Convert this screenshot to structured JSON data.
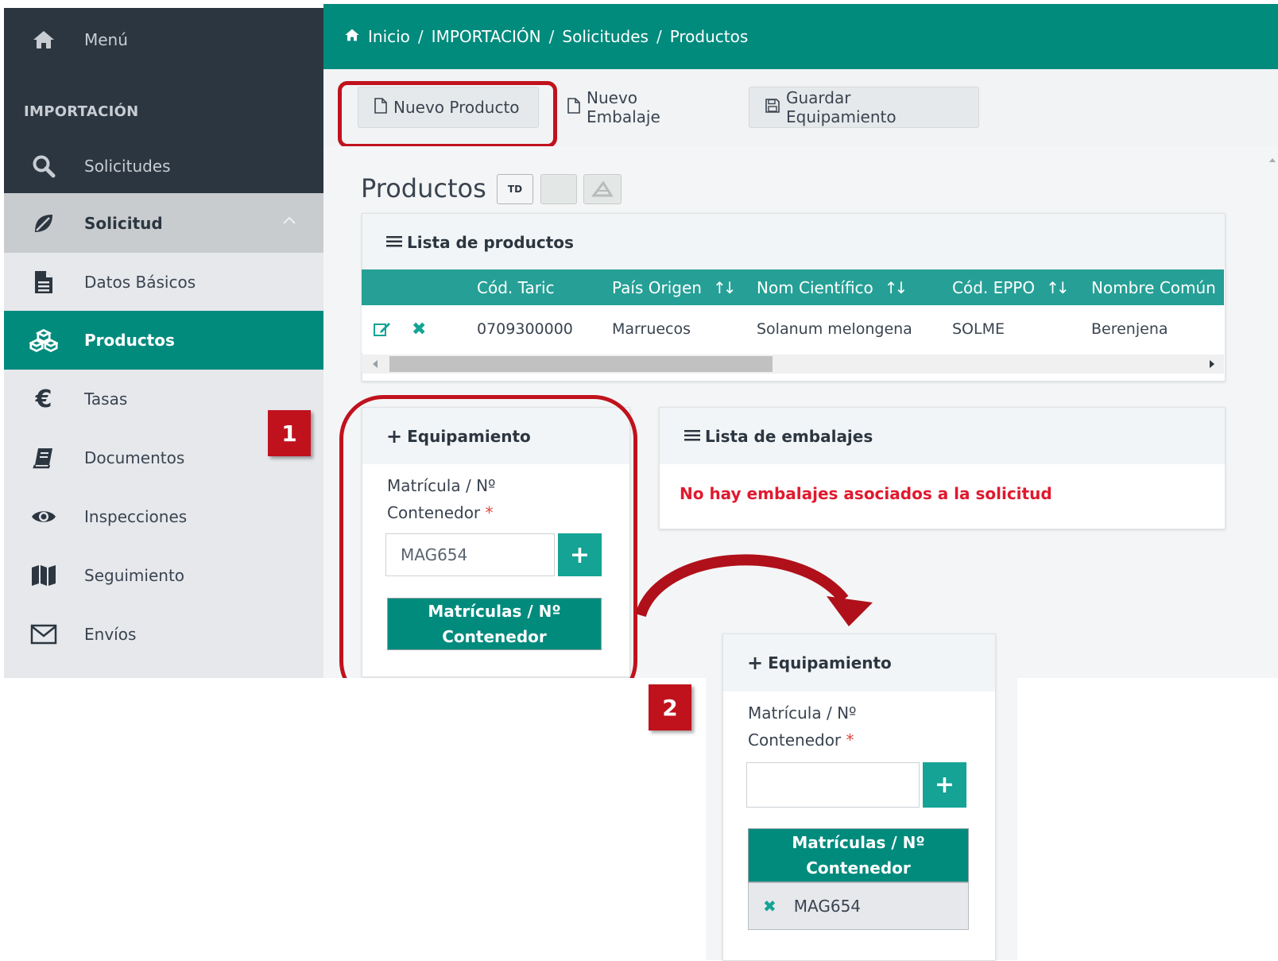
{
  "colors": {
    "primary": "#008b7d",
    "sidebar_dark": "#2c3640",
    "annotation_red": "#c0121d",
    "error_red": "#e0192e"
  },
  "sidebar": {
    "menu_label": "Menú",
    "section_title": "IMPORTACIÓN",
    "items": [
      {
        "label": "Solicitudes",
        "icon": "search-icon"
      },
      {
        "label": "Solicitud",
        "icon": "leaf-icon"
      },
      {
        "label": "Datos Básicos",
        "icon": "document-icon"
      },
      {
        "label": "Productos",
        "icon": "cubes-icon"
      },
      {
        "label": "Tasas",
        "icon": "euro-icon"
      },
      {
        "label": "Documentos",
        "icon": "book-icon"
      },
      {
        "label": "Inspecciones",
        "icon": "eye-icon"
      },
      {
        "label": "Seguimiento",
        "icon": "map-icon"
      },
      {
        "label": "Envíos",
        "icon": "envelope-icon"
      }
    ],
    "active_item": "Productos"
  },
  "breadcrumb": [
    "Inicio",
    "IMPORTACIÓN",
    "Solicitudes",
    "Productos"
  ],
  "toolbar": {
    "new_product": "Nuevo Producto",
    "new_packaging": "Nuevo Embalaje",
    "save_equipment": "Guardar Equipamiento"
  },
  "page": {
    "title": "Productos",
    "td_label": "TD"
  },
  "products_panel": {
    "title": "Lista de productos",
    "columns": [
      "Cód. Taric",
      "País Origen",
      "Nom Científico",
      "Cód. EPPO",
      "Nombre Común"
    ],
    "rows": [
      {
        "taric": "0709300000",
        "origin": "Marruecos",
        "scientific": "Solanum melongena",
        "eppo": "SOLME",
        "common": "Berenjena"
      }
    ]
  },
  "equipment_panel": {
    "title": "Equipamiento",
    "label_line1": "Matrícula / Nº",
    "label_line2": "Contenedor",
    "required_mark": "*",
    "input_value": "MAG654",
    "add_symbol": "+",
    "list_header_line1": "Matrículas / Nº",
    "list_header_line2": "Contenedor"
  },
  "packaging_panel": {
    "title": "Lista de embalajes",
    "empty_message": "No hay embalajes asociados a la solicitud"
  },
  "equipment_panel_after": {
    "title": "Equipamiento",
    "label_line1": "Matrícula / Nº",
    "label_line2": "Contenedor",
    "required_mark": "*",
    "input_value": "",
    "add_symbol": "+",
    "list_header_line1": "Matrículas / Nº",
    "list_header_line2": "Contenedor",
    "items": [
      "MAG654"
    ]
  },
  "annotations": {
    "step1": "1",
    "step2": "2"
  }
}
